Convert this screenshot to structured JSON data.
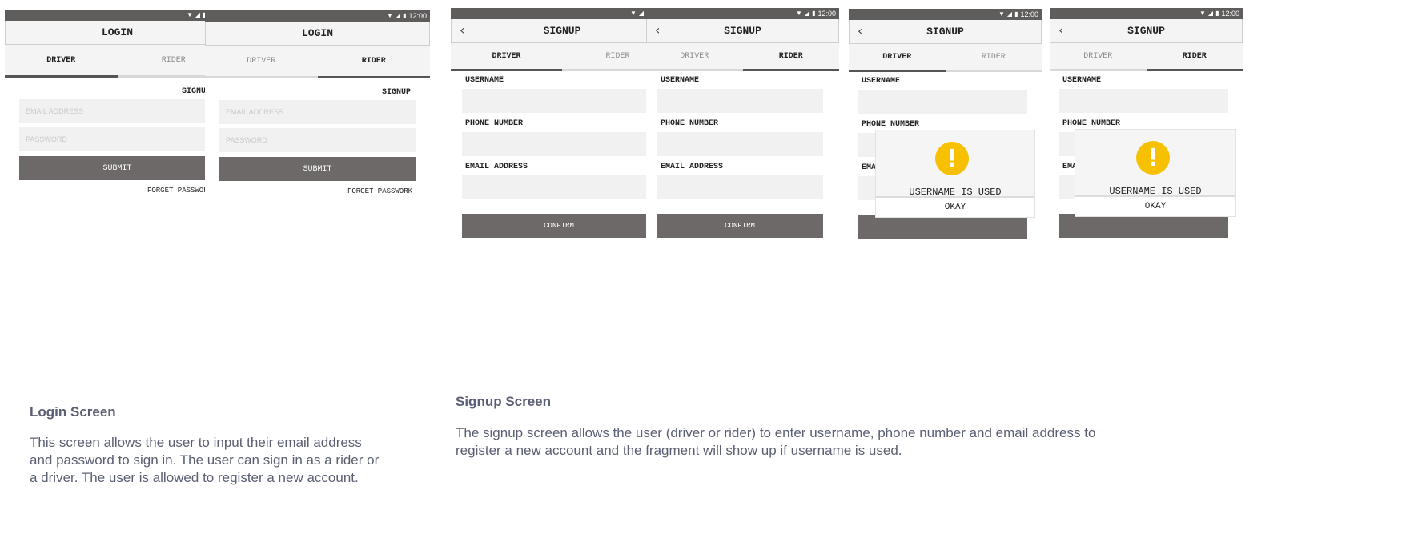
{
  "status": {
    "time": "12:00"
  },
  "login_screens": [
    {
      "title": "LOGIN",
      "tabs": [
        {
          "label": "DRIVER"
        },
        {
          "label": "RIDER"
        }
      ],
      "active_tab": "DRIVER",
      "signup_link": "SIGNUP",
      "email_placeholder": "EMAIL ADDRESS",
      "password_placeholder": "PASSWORD",
      "submit_label": "SUBMIT",
      "forget_label": "FORGET PASSWORK"
    },
    {
      "title": "LOGIN",
      "tabs": [
        {
          "label": "DRIVER"
        },
        {
          "label": "RIDER"
        }
      ],
      "active_tab": "RIDER",
      "signup_link": "SIGNUP",
      "email_placeholder": "EMAIL ADDRESS",
      "password_placeholder": "PASSWORD",
      "submit_label": "SUBMIT",
      "forget_label": "FORGET PASSWORK"
    }
  ],
  "signup_screens": [
    {
      "title": "SIGNUP",
      "tabs": [
        {
          "label": "DRIVER"
        },
        {
          "label": "RIDER"
        }
      ],
      "active_tab": "DRIVER",
      "username_label": "USERNAME",
      "phone_label": "PHONE NUMBER",
      "email_label": "EMAIL ADDRESS",
      "confirm_label": "CONFIRM"
    },
    {
      "title": "SIGNUP",
      "tabs": [
        {
          "label": "DRIVER"
        },
        {
          "label": "RIDER"
        }
      ],
      "active_tab": "RIDER",
      "username_label": "USERNAME",
      "phone_label": "PHONE NUMBER",
      "email_label": "EMAIL ADDRESS",
      "confirm_label": "CONFIRM"
    },
    {
      "title": "SIGNUP",
      "tabs": [
        {
          "label": "DRIVER"
        },
        {
          "label": "RIDER"
        }
      ],
      "active_tab": "DRIVER",
      "username_label": "USERNAME",
      "phone_label": "PHONE NUMBER",
      "email_label": "EMA",
      "confirm_label": "",
      "dialog": {
        "message": "USERNAME IS USED",
        "button": "OKAY",
        "icon": "!"
      }
    },
    {
      "title": "SIGNUP",
      "tabs": [
        {
          "label": "DRIVER"
        },
        {
          "label": "RIDER"
        }
      ],
      "active_tab": "RIDER",
      "username_label": "USERNAME",
      "phone_label": "PHONE NUMBER",
      "email_label": "EMA",
      "confirm_label": "",
      "dialog": {
        "message": "USERNAME IS USED",
        "button": "OKAY",
        "icon": "!"
      }
    }
  ],
  "captions": {
    "login_heading": "Login Screen",
    "login_text_lines": [
      "This screen allows the user to input their email address",
      "and password to sign in. The user can sign in as a rider or",
      "a driver. The user is allowed to register a new account."
    ],
    "signup_heading": "Signup Screen",
    "signup_text_lines": [
      "The signup screen allows the user (driver or rider) to enter username, phone number and email address to",
      "register a new account and the fragment will show up if username is used."
    ]
  },
  "colors": {
    "statusbar": "#5f5c5c",
    "button": "#6d6969",
    "warning": "#f7c000",
    "caption": "#5b5f73"
  }
}
